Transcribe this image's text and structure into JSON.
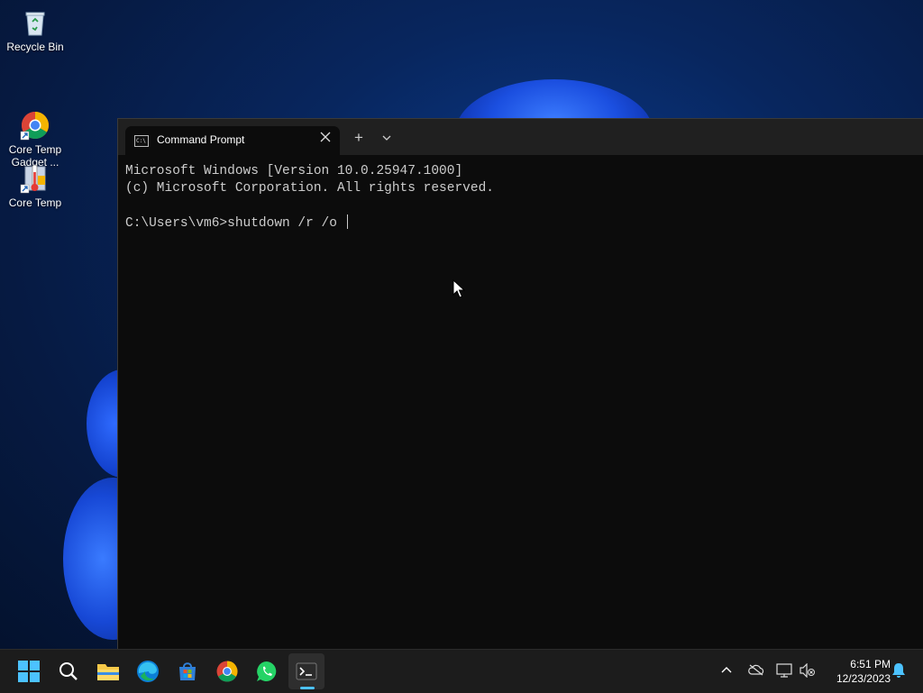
{
  "desktop": {
    "icons": [
      {
        "label": "Recycle Bin",
        "icon": "recycle-bin-icon"
      },
      {
        "label": "Core Temp\nGadget ...",
        "icon": "chrome-shortcut-icon"
      },
      {
        "label": "Core Temp",
        "icon": "core-temp-icon"
      }
    ]
  },
  "terminal": {
    "tab_title": "Command Prompt",
    "tab_icon": "C:\\",
    "new_tab_symbol": "+",
    "lines": [
      "Microsoft Windows [Version 10.0.25947.1000]",
      "(c) Microsoft Corporation. All rights reserved.",
      "",
      "C:\\Users\\vm6>shutdown /r /o "
    ]
  },
  "taskbar": {
    "apps": [
      "windows-start-icon",
      "search-icon",
      "file-explorer-icon",
      "edge-icon",
      "microsoft-store-icon",
      "chrome-icon",
      "whatsapp-icon",
      "terminal-icon"
    ],
    "tray_icons": [
      "chevron-up-icon",
      "onedrive-icon",
      "network-icon",
      "volume-muted-icon"
    ],
    "time": "6:51 PM",
    "date": "12/23/2023"
  },
  "colors": {
    "accent": "#4cc2ff",
    "console_bg": "#0c0c0c",
    "console_text": "#cccccc",
    "taskbar_bg": "#1c1c1c"
  }
}
